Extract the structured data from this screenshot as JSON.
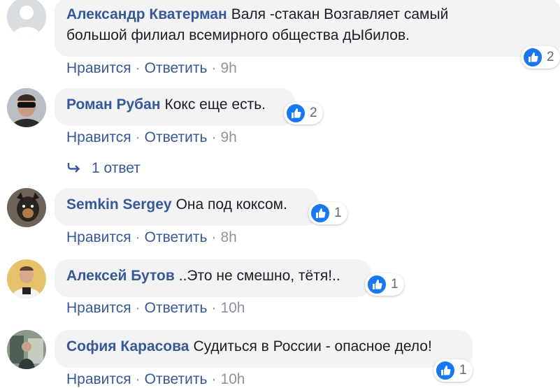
{
  "actions": {
    "like": "Нравится",
    "reply": "Ответить",
    "separator": "·"
  },
  "comments": [
    {
      "author": "Александр Кватерман",
      "line1": "Валя -стакан Возгавляет самый",
      "line2": "большой филиал всемирного общества дЫбилов.",
      "likes": "2",
      "time": "9h"
    },
    {
      "author": "Роман Рубан",
      "line1": "Кокс еще есть.",
      "likes": "2",
      "time": "9h",
      "replies": "1 ответ"
    },
    {
      "author": "Semkin Sergey",
      "line1": "Она под коксом.",
      "likes": "1",
      "time": "8h"
    },
    {
      "author": "Алексей Бутов",
      "line1": "..Это не смешно, тётя!..",
      "likes": "1",
      "time": "10h"
    },
    {
      "author": "София Карасова",
      "line1": "Судиться в России - опасное дело!",
      "likes": "1",
      "time": "10h"
    }
  ],
  "colors": {
    "link": "#385898",
    "meta": "#90949c",
    "bubble": "#f2f3f5",
    "like": "#1877f2"
  }
}
